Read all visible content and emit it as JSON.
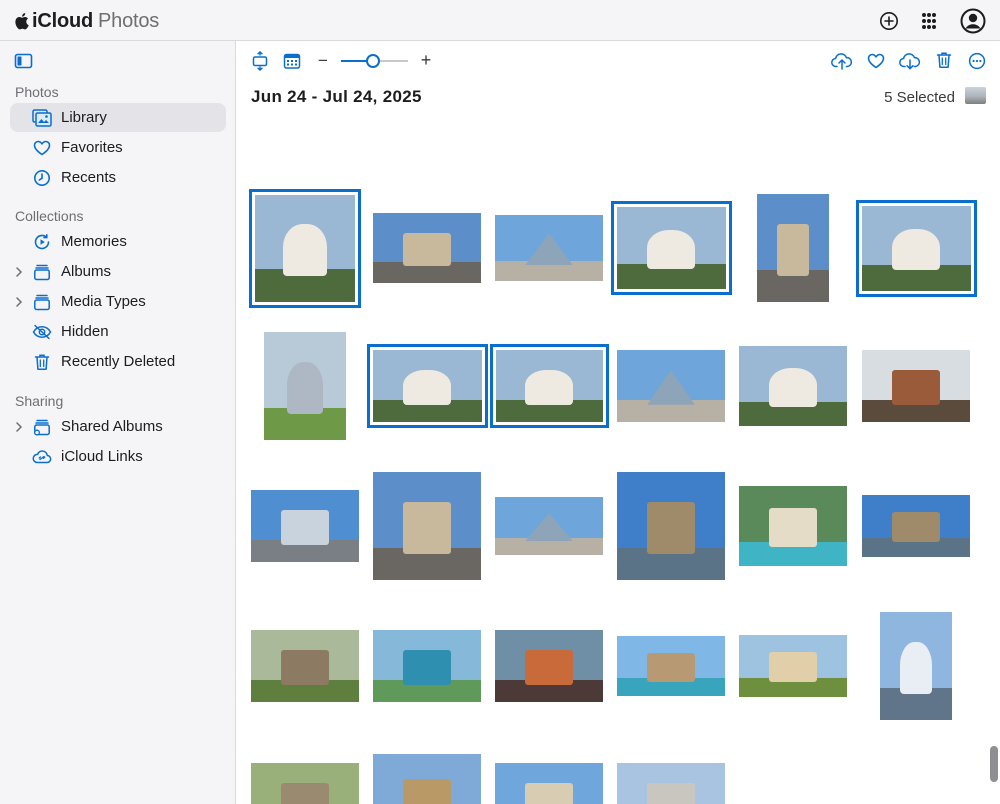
{
  "header": {
    "brand": "iCloud",
    "app": "Photos",
    "icons": [
      "add-icon",
      "app-grid-icon",
      "account-icon"
    ]
  },
  "sidebar": {
    "sections": [
      {
        "title": "Photos",
        "items": [
          {
            "label": "Library",
            "icon": "library-icon",
            "active": true
          },
          {
            "label": "Favorites",
            "icon": "heart-icon"
          },
          {
            "label": "Recents",
            "icon": "clock-icon"
          }
        ]
      },
      {
        "title": "Collections",
        "items": [
          {
            "label": "Memories",
            "icon": "memories-icon"
          },
          {
            "label": "Albums",
            "icon": "albums-icon",
            "expandable": true
          },
          {
            "label": "Media Types",
            "icon": "media-types-icon",
            "expandable": true
          },
          {
            "label": "Hidden",
            "icon": "eye-slash-icon"
          },
          {
            "label": "Recently Deleted",
            "icon": "trash-icon"
          }
        ]
      },
      {
        "title": "Sharing",
        "items": [
          {
            "label": "Shared Albums",
            "icon": "shared-albums-icon",
            "expandable": true
          },
          {
            "label": "iCloud Links",
            "icon": "cloud-link-icon"
          }
        ]
      }
    ]
  },
  "toolbar": {
    "left_icons": [
      "aspect-icon",
      "calendar-icon"
    ],
    "zoom_minus": "−",
    "zoom_plus": "+",
    "zoom_level": 0.48,
    "right_icons": [
      "upload-icon",
      "favorite-icon",
      "download-icon",
      "delete-icon",
      "more-icon"
    ]
  },
  "main": {
    "date_range": "Jun 24 - Jul 24, 2025",
    "selected_label": "5 Selected"
  },
  "colors": {
    "accent": "#0a6ecf",
    "sidebar_bg": "#f5f5f7",
    "active_item": "#e3e3e8"
  },
  "photos": [
    {
      "subject": "basilica",
      "selected": true
    },
    {
      "subject": "arch"
    },
    {
      "subject": "pyramid"
    },
    {
      "subject": "basilica",
      "selected": true
    },
    {
      "subject": "arch"
    },
    {
      "subject": "basilica",
      "selected": true
    },
    {
      "subject": "dome"
    },
    {
      "subject": "basilica",
      "selected": true
    },
    {
      "subject": "basilica",
      "selected": true
    },
    {
      "subject": "pyramid"
    },
    {
      "subject": "basilica"
    },
    {
      "subject": "carousel"
    },
    {
      "subject": "fountain"
    },
    {
      "subject": "arch"
    },
    {
      "subject": "pyramid"
    },
    {
      "subject": "bridge"
    },
    {
      "subject": "beach"
    },
    {
      "subject": "bridge"
    },
    {
      "subject": "village"
    },
    {
      "subject": "coast"
    },
    {
      "subject": "bigben"
    },
    {
      "subject": "rockarch"
    },
    {
      "subject": "cove"
    },
    {
      "subject": "wheel"
    },
    {
      "subject": "cottage"
    },
    {
      "subject": "abbey"
    },
    {
      "subject": "castle"
    },
    {
      "subject": "square"
    }
  ]
}
